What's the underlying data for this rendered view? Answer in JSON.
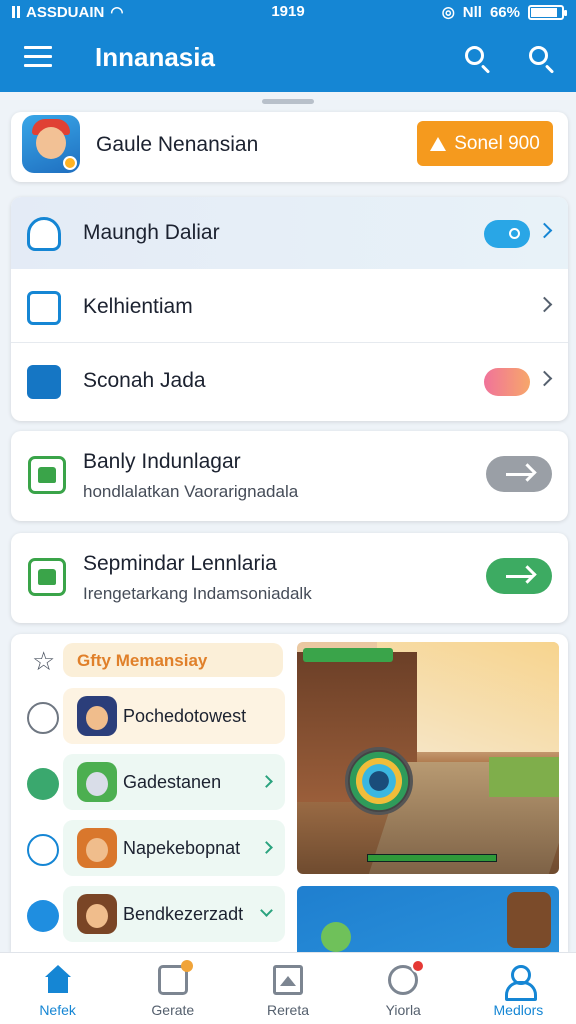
{
  "status_bar": {
    "carrier": "ASSDUAIN",
    "time": "1919",
    "battery": "66%",
    "network": "Nll"
  },
  "app_bar": {
    "title": "Innanasia",
    "icons": [
      "menu-icon",
      "search-icon",
      "search-icon"
    ]
  },
  "hero": {
    "title": "Gaule Nenansian",
    "button_label": "Sonel 900",
    "button_color": "#f59a1e"
  },
  "settings_list": {
    "items": [
      {
        "label": "Maungh Daliar",
        "icon": "shield-icon",
        "toggle_color": "#29a6e6"
      },
      {
        "label": "Kelhientiam",
        "icon": "edit-icon"
      },
      {
        "label": "Sconah Jada",
        "icon": "grid-icon",
        "toggle_color": "#f0739a"
      }
    ]
  },
  "feature_cards": [
    {
      "title": "Banly Indunlagar",
      "subtitle": "hondlalatkan Vaorarignadala",
      "button_color": "#9a9fa6"
    },
    {
      "title": "Sepmindar Lennlaria",
      "subtitle": "Irengetarkang Indamsoniadalk",
      "button_color": "#3dab62"
    }
  ],
  "games_panel": {
    "header": "Gfty Memansiay",
    "header_icon": "star-icon",
    "items": [
      {
        "name": "Pochedotowest",
        "lead_icon": "share-icon"
      },
      {
        "name": "Gadestanen",
        "lead_icon": "compass-icon"
      },
      {
        "name": "Napekebopnat",
        "lead_icon": "plane-icon"
      },
      {
        "name": "Bendkezerzadt",
        "lead_icon": "link-icon"
      }
    ]
  },
  "tabs": [
    {
      "label": "Nefek",
      "icon": "home-icon",
      "active": true
    },
    {
      "label": "Gerate",
      "icon": "box-icon"
    },
    {
      "label": "Rereta",
      "icon": "document-icon"
    },
    {
      "label": "Yiorla",
      "icon": "globe-icon"
    },
    {
      "label": "Medlors",
      "icon": "person-icon",
      "active": true
    }
  ],
  "colors": {
    "primary": "#1586d4",
    "accent_orange": "#f59a1e",
    "green": "#3aa449"
  }
}
